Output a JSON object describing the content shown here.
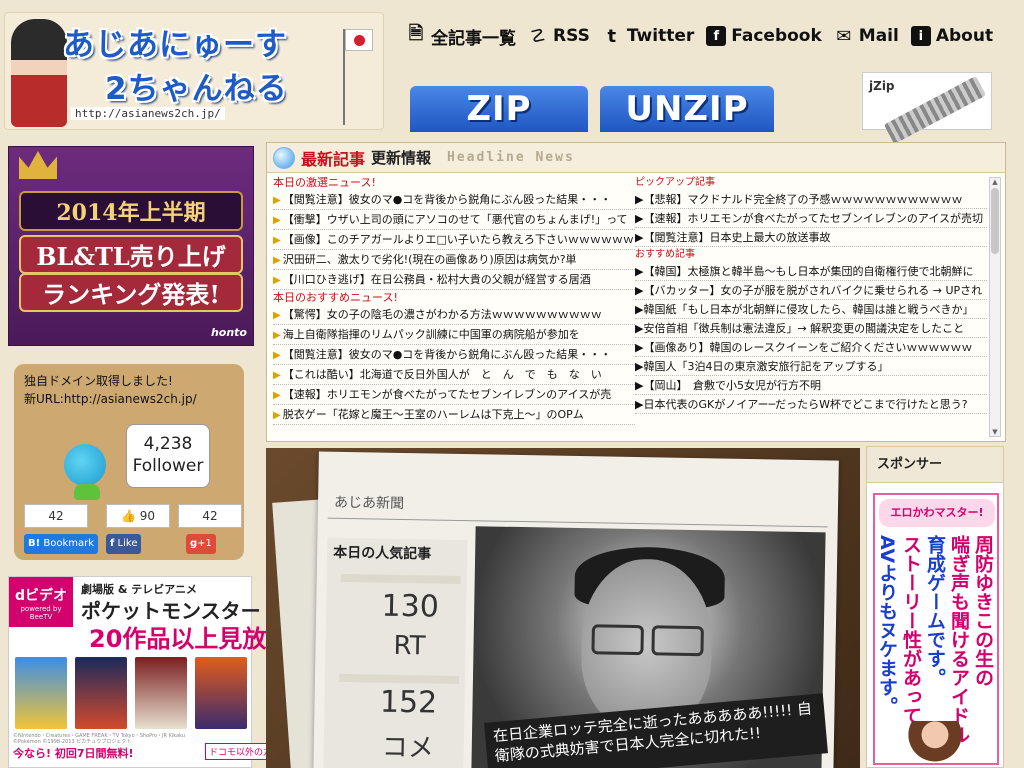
{
  "header": {
    "logo_line1": "あじあにゅーす",
    "logo_line2": "2ちゃんねる",
    "logo_url": "http://asianews2ch.jp/",
    "nav": [
      {
        "label": "全記事一覧",
        "icon": "document-icon"
      },
      {
        "label": "RSS",
        "icon": "rss-icon"
      },
      {
        "label": "Twitter",
        "icon": "twitter-icon"
      },
      {
        "label": "Facebook",
        "icon": "facebook-icon"
      },
      {
        "label": "Mail",
        "icon": "mail-icon"
      },
      {
        "label": "About",
        "icon": "info-icon"
      }
    ],
    "zip_label": "ZIP",
    "unzip_label": "UNZIP",
    "jzip_label": "jZip"
  },
  "ad_bltl": {
    "line1": "2014年上半期",
    "line2": "BL&TL売り上げ",
    "line3": "ランキング発表!",
    "brand": "honto"
  },
  "follow": {
    "line1": "独自ドメイン取得しました!",
    "line2": "新URL:http://asianews2ch.jp/",
    "follower_count": "4,238",
    "follower_label": "Follower",
    "hatena_count": "42",
    "like_count": "90",
    "gplus_count": "42",
    "hatena_label": "Bookmark",
    "like_label": "Like",
    "gplus_label": "+1"
  },
  "ad_pokemon": {
    "badge": "dビデオ",
    "badge_sub": "powered by BeeTV",
    "line1": "劇場版 & テレビアニメ",
    "line2": "ポケットモンスター",
    "line3": "20作品以上見放題!",
    "fine": "©Nintendo・Creatures・GAME FREAK・TV Tokyo・ShoPro・JR Kikaku ©Pokémon ©1998-2013 ピカチュウプロジェクト",
    "bottom": "今なら! 初回7日間無料!",
    "sidebox": "ドコモ以外の方も視聴可能"
  },
  "headline": {
    "title_red": "最新記事",
    "title_black": "更新情報",
    "title_en": "Headline News",
    "left_section1": "本日の激選ニュース!",
    "left_section2": "本日のおすすめニュース!",
    "left_items1": [
      "【閲覧注意】彼女のマ●コを背後から鋭角にぶん殴った結果・・・",
      "【衝撃】ウザい上司の頭にアソコのせて「悪代官のちょんまげ!」って",
      "【画像】このチアガールよりエ□い子いたら教えろ下さいｗｗｗｗｗｗ",
      "沢田研二、激太りで劣化!(現在の画像あり)原因は病気か?単",
      "【川口ひき逃げ】在日公務員・松村大貴の父親が経営する居酒"
    ],
    "left_items2": [
      "【驚愕】女の子の陰毛の濃さがわかる方法ｗｗｗｗｗｗｗｗｗｗ",
      "海上自衛隊指揮のリムパック訓練に中国軍の病院船が参加を",
      "【閲覧注意】彼女のマ●コを背後から鋭角にぶん殴った結果・・・",
      "【これは酷い】北海道で反日外国人が　と　ん　で　も　な　い",
      "【速報】ホリエモンが食べたがってたセブンイレブンのアイスが売",
      "脱衣ゲー「花嫁と魔王～王室のハーレムは下克上～」のOPム"
    ],
    "right_section1": "ピックアップ記事",
    "right_section2": "おすすめ記事",
    "right_items1": [
      "【悲報】マクドナルド完全終了の予感ｗｗｗｗｗｗｗｗｗｗｗｗ",
      "【速報】ホリエモンが食べたがってたセブンイレブンのアイスが売切",
      "【閲覧注意】日本史上最大の放送事故"
    ],
    "right_items2": [
      "【韓国】太極旗と韓半島～もし日本が集団的自衛権行使で北朝鮮に",
      "【バカッター】女の子が服を脱がされバイクに乗せられる → UPされ",
      "韓国紙「もし日本が北朝鮮に侵攻したら、韓国は誰と戦うべきか」",
      "安倍首相「徴兵制は憲法違反」→ 解釈変更の閣議決定をしたこと",
      "【画像あり】韓国のレースクイーンをご紹介くださいｗｗｗｗｗｗ",
      "韓国人「3泊4日の東京激安旅行記をアップする」",
      "【岡山】　倉敷で小5女児が行方不明",
      "日本代表のGKがノイアー─だったらW杯でどこまで行けたと思う?"
    ]
  },
  "paper": {
    "title": "あじあ新聞",
    "stat_label": "本日の人気記事",
    "rt_value": "130",
    "rt_label": "RT",
    "com_value": "152",
    "com_label": "コメ",
    "caption": "在日企業ロッテ完全に逝ったあああああ!!!!! 自衛隊の式典妨害で日本人完全に切れた!!"
  },
  "sponsor": {
    "header": "スポンサー",
    "ad_title": "エロかわマスター!",
    "col1": "周防ゆきこの生の",
    "col2": "喘ぎ声も聞けるアイドル",
    "col3": "育成ゲームです。",
    "col4": "ストーリー性があって",
    "col5": "AVよりもヌケます。"
  },
  "colors": {
    "brand_blue": "#1e5bc6",
    "headline_red": "#c8101c",
    "accent_pink": "#d4006d",
    "page_bg": "#efe6d2"
  }
}
